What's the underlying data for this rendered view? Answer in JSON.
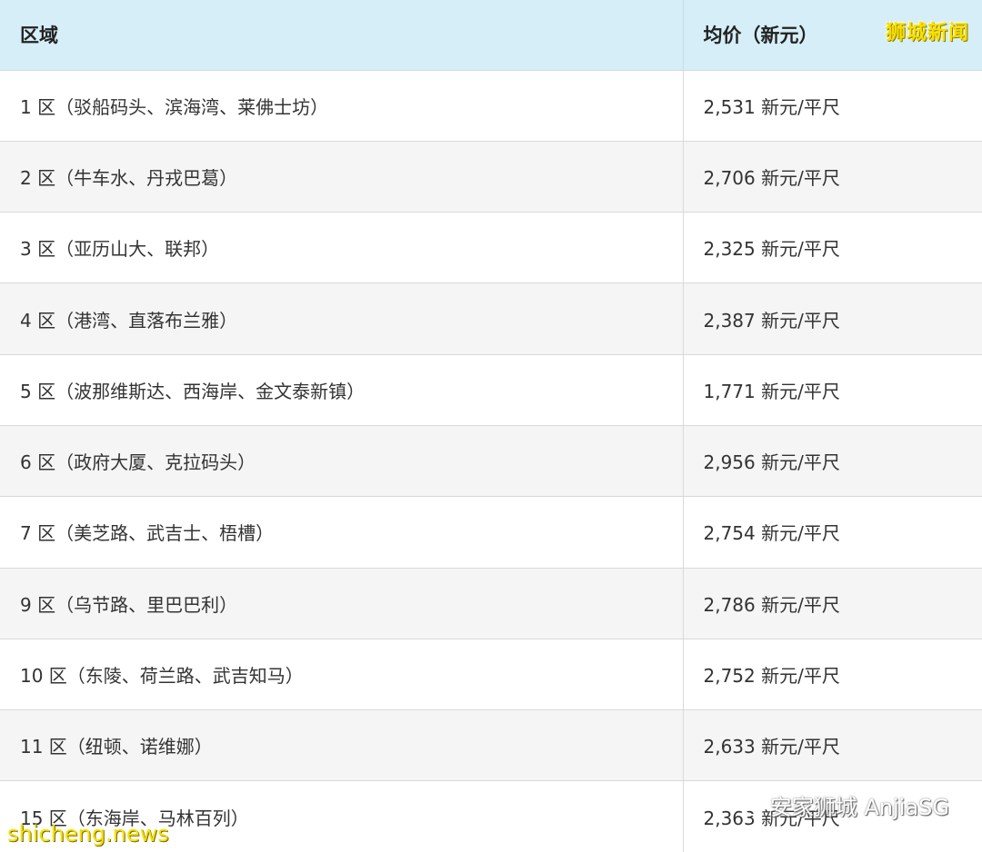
{
  "table": {
    "headers": [
      "区域",
      "均价（新元）"
    ],
    "rows": [
      {
        "district": "1 区（驳船码头、滨海湾、莱佛士坊）",
        "price": "2,531 新元/平尺"
      },
      {
        "district": "2 区（牛车水、丹戎巴葛）",
        "price": "2,706 新元/平尺"
      },
      {
        "district": "3 区（亚历山大、联邦）",
        "price": "2,325 新元/平尺"
      },
      {
        "district": "4 区（港湾、直落布兰雅）",
        "price": "2,387 新元/平尺"
      },
      {
        "district": "5 区（波那维斯达、西海岸、金文泰新镇）",
        "price": "1,771 新元/平尺"
      },
      {
        "district": "6 区（政府大厦、克拉码头）",
        "price": "2,956 新元/平尺"
      },
      {
        "district": "7 区（美芝路、武吉士、梧槽）",
        "price": "2,754 新元/平尺"
      },
      {
        "district": "9 区（乌节路、里巴巴利）",
        "price": "2,786 新元/平尺"
      },
      {
        "district": "10 区（东陵、荷兰路、武吉知马）",
        "price": "2,752 新元/平尺"
      },
      {
        "district": "11 区（纽顿、诺维娜）",
        "price": "2,633 新元/平尺"
      },
      {
        "district": "15 区（东海岸、马林百列）",
        "price": "2,363 新元/平尺"
      }
    ]
  },
  "watermarks": {
    "top_right": "狮城新闻",
    "bottom_left": "shicheng.news",
    "bottom_right": "安家狮城 AnjiaSG",
    "bottom_right_icon": "wechat-icon"
  },
  "colors": {
    "header_bg": "#d6eef7",
    "row_alt_bg": "#f5f5f5",
    "watermark_yellow": "#f7e000"
  }
}
